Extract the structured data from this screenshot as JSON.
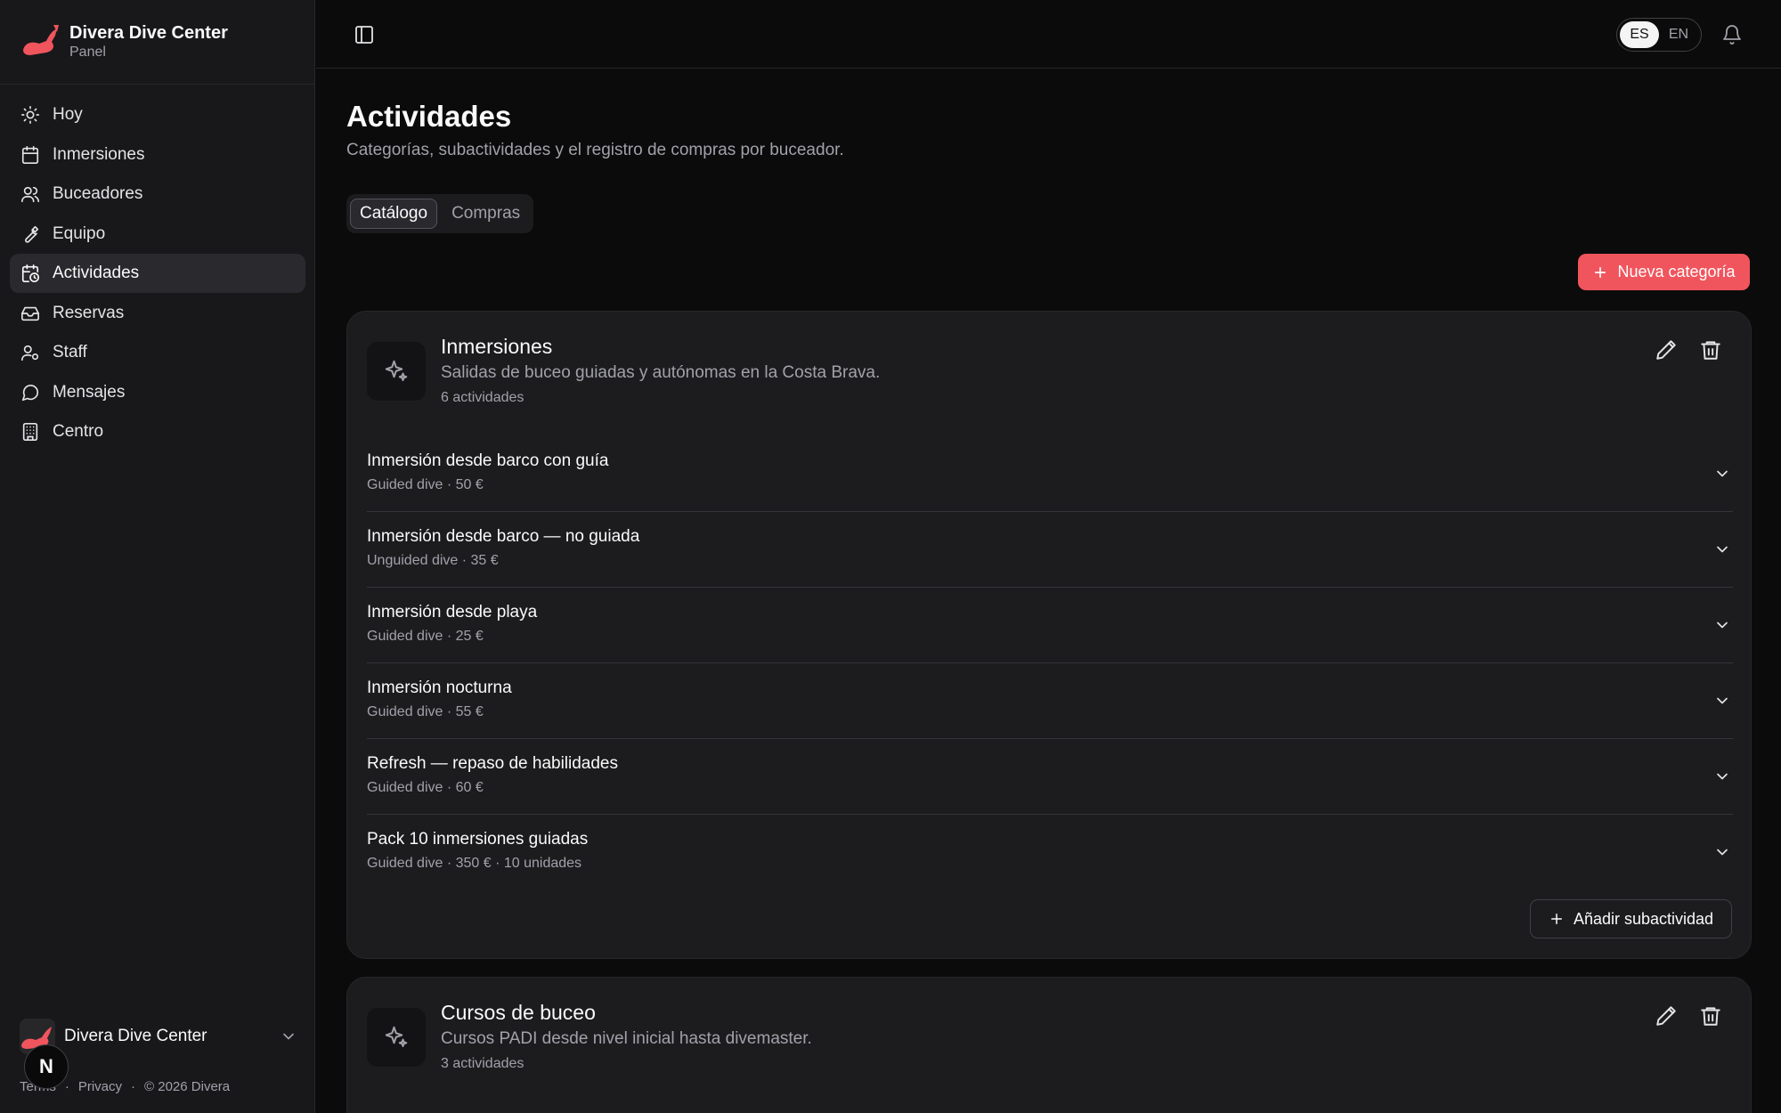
{
  "brand": {
    "name": "Divera Dive Center",
    "subtitle": "Panel"
  },
  "nav": [
    {
      "label": "Hoy",
      "icon": "sun-icon"
    },
    {
      "label": "Inmersiones",
      "icon": "calendar-icon"
    },
    {
      "label": "Buceadores",
      "icon": "users-icon"
    },
    {
      "label": "Equipo",
      "icon": "wrench-icon"
    },
    {
      "label": "Actividades",
      "icon": "calendar-clock-icon",
      "active": true
    },
    {
      "label": "Reservas",
      "icon": "inbox-icon"
    },
    {
      "label": "Staff",
      "icon": "user-cog-icon"
    },
    {
      "label": "Mensajes",
      "icon": "message-icon"
    },
    {
      "label": "Centro",
      "icon": "building-icon"
    }
  ],
  "footer": {
    "center_name": "Divera Dive Center",
    "legal": [
      "Terms",
      "Privacy",
      "© 2026 Divera"
    ],
    "badge": "N"
  },
  "topbar": {
    "lang_es": "ES",
    "lang_en": "EN",
    "lang_selected": "ES"
  },
  "page": {
    "title": "Actividades",
    "subtitle": "Categorías, subactividades y el registro de compras por buceador.",
    "tabs": [
      "Catálogo",
      "Compras"
    ],
    "new_category": "Nueva categoría"
  },
  "categories": [
    {
      "title": "Inmersiones",
      "description": "Salidas de buceo guiadas y autónomas en la Costa Brava.",
      "count": "6 actividades",
      "items": [
        {
          "name": "Inmersión desde barco con guía",
          "meta": "Guided dive  ·  50 €"
        },
        {
          "name": "Inmersión desde barco — no guiada",
          "meta": "Unguided dive  ·  35 €"
        },
        {
          "name": "Inmersión desde playa",
          "meta": "Guided dive  ·  25 €"
        },
        {
          "name": "Inmersión nocturna",
          "meta": "Guided dive  ·  55 €"
        },
        {
          "name": "Refresh — repaso de habilidades",
          "meta": "Guided dive  ·  60 €"
        },
        {
          "name": "Pack 10 inmersiones guiadas",
          "meta": "Guided dive  ·  350 €  ·  10 unidades"
        }
      ],
      "add_sub": "Añadir subactividad"
    },
    {
      "title": "Cursos de buceo",
      "description": "Cursos PADI desde nivel inicial hasta divemaster.",
      "count": "3 actividades"
    }
  ],
  "colors": {
    "accent": "#f0545c",
    "background": "#0b0b0c",
    "sidebar": "#18181b",
    "card": "#1c1c1f"
  }
}
